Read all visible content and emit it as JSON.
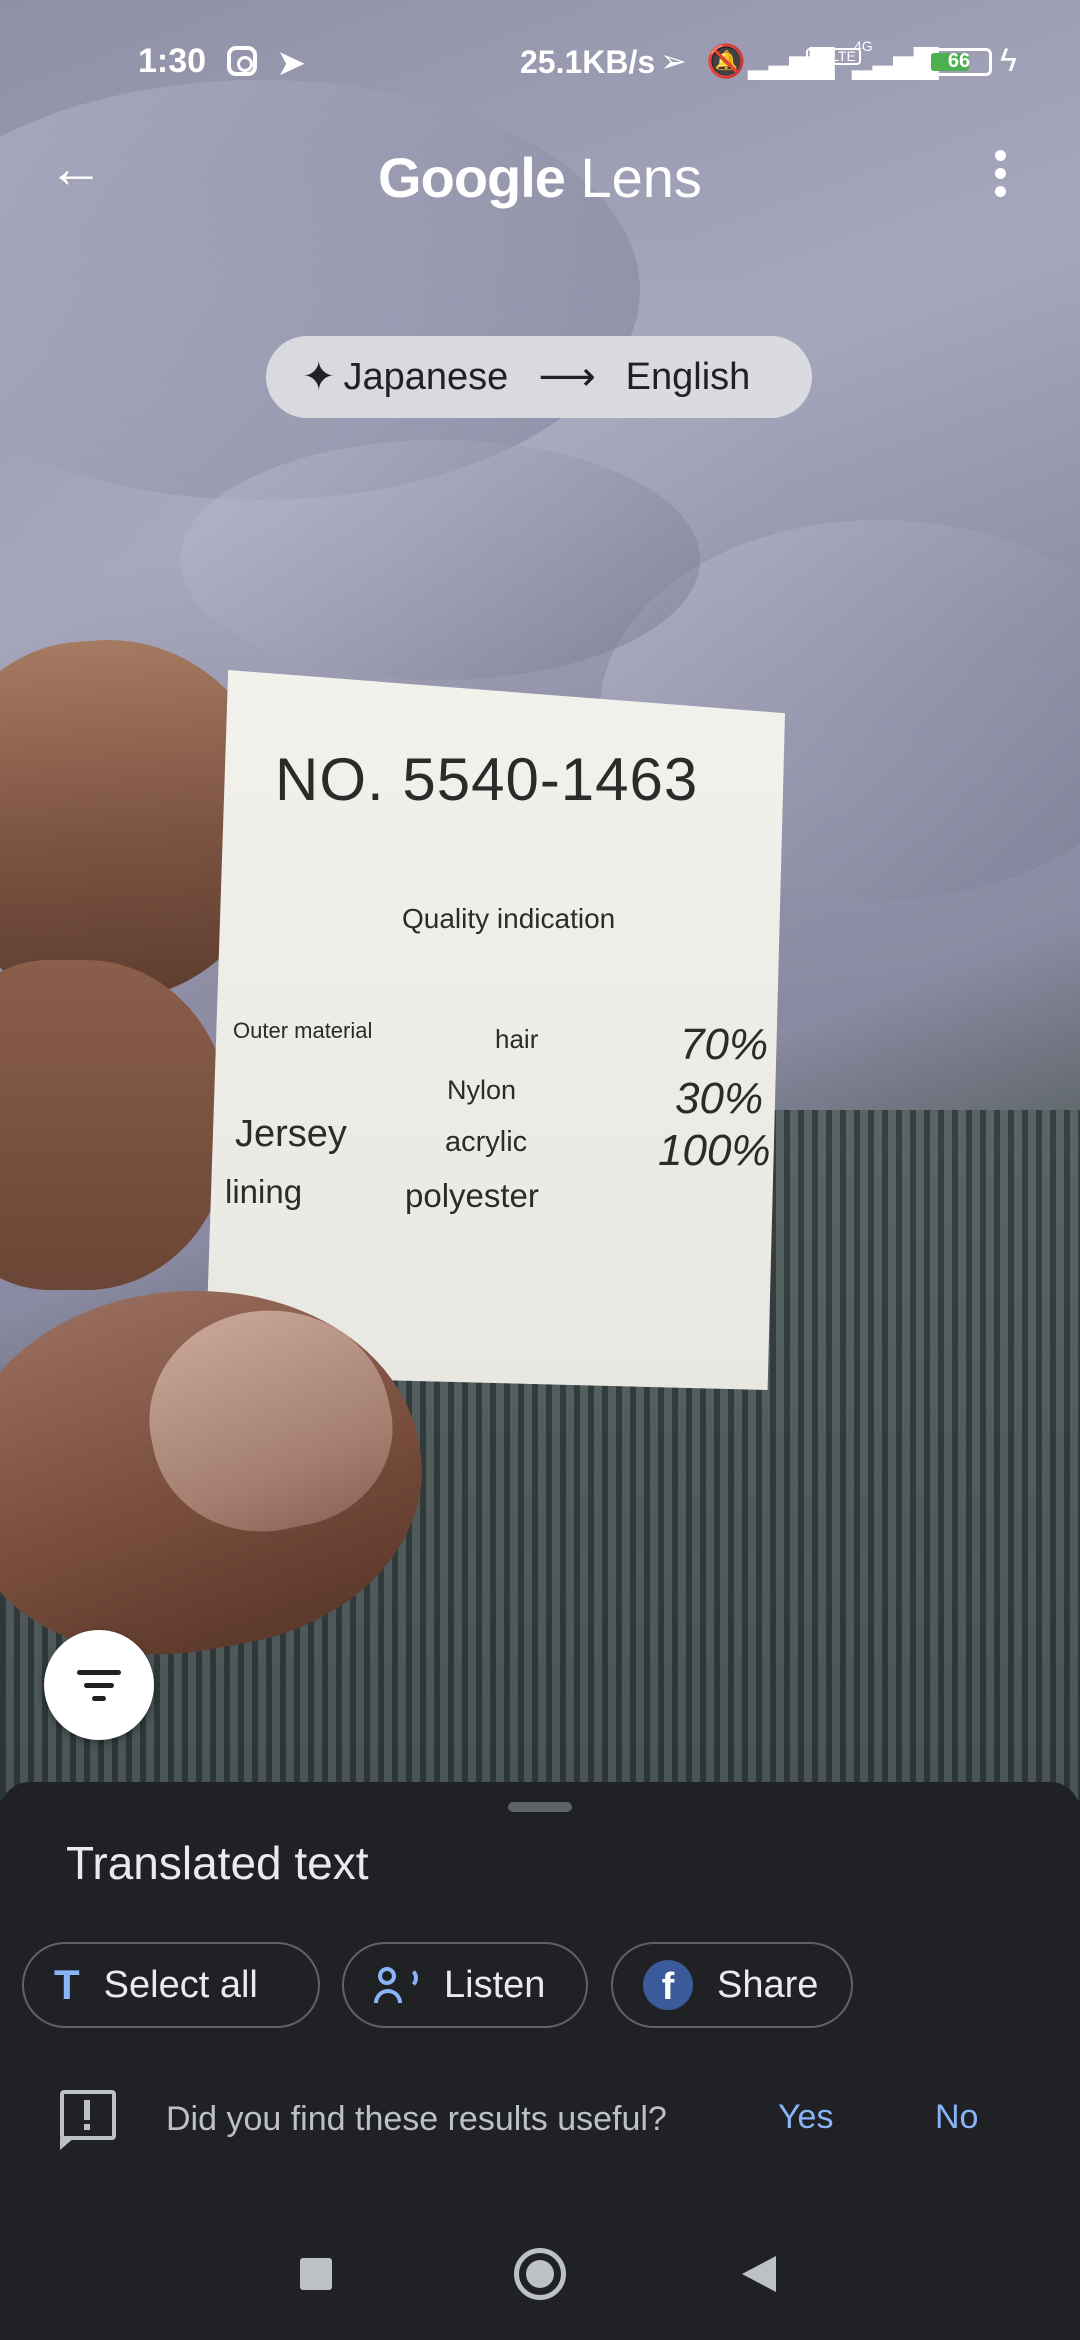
{
  "status_bar": {
    "time": "1:30",
    "network_speed": "25.1KB/s",
    "network_type": "4G",
    "volte": "Vo LTE",
    "battery_level": "66",
    "icons": [
      "instagram-icon",
      "telegram-icon",
      "location-icon",
      "mute-icon",
      "signal-icon",
      "volte-icon",
      "signal-4g-icon",
      "battery-icon",
      "charging-icon"
    ]
  },
  "app_bar": {
    "title_brand": "Google",
    "title_product": "Lens",
    "back_icon": "arrow-left-icon",
    "menu_icon": "more-vert-icon"
  },
  "language_chip": {
    "source": "Japanese",
    "arrow": "⟶",
    "target": "English",
    "icon": "sparkle-icon"
  },
  "label_overlay": {
    "number": "NO. 5540-1463",
    "heading": "Quality indication",
    "outer_material": "Outer material",
    "hair": "hair",
    "nylon": "Nylon",
    "acrylic": "acrylic",
    "jersey": "Jersey",
    "lining": "lining",
    "polyester": "polyester",
    "pct_hair": "70%",
    "pct_nylon": "30%",
    "pct_acrylic": "100%"
  },
  "filter_button": {
    "icon": "filter-list-icon"
  },
  "bottom_sheet": {
    "title": "Translated text",
    "actions": [
      {
        "label": "Select all",
        "icon": "text-select-icon"
      },
      {
        "label": "Listen",
        "icon": "listen-icon"
      },
      {
        "label": "Share",
        "icon": "facebook-icon"
      }
    ],
    "feedback": {
      "question": "Did you find these results useful?",
      "yes": "Yes",
      "no": "No",
      "icon": "feedback-icon"
    }
  },
  "colors": {
    "accent": "#8ab4f8",
    "sheet_background": "#202124",
    "chip_background": "#dedee4",
    "battery_fill": "#4caf50"
  }
}
